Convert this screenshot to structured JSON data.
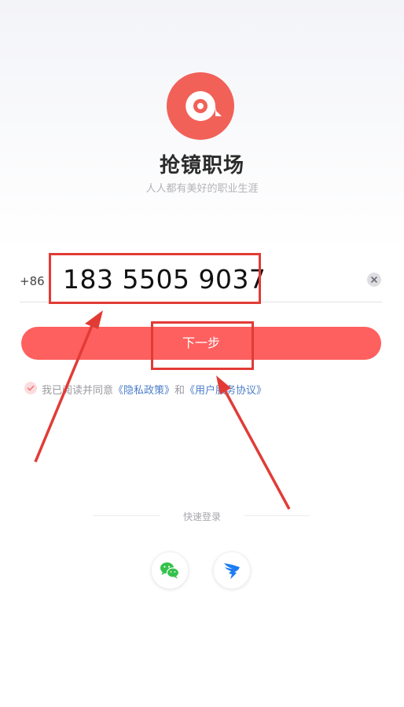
{
  "app": {
    "name": "抢镜职场",
    "slogan": "人人都有美好的职业生涯"
  },
  "login": {
    "country_code": "+86",
    "phone_value": "183 5505 9037",
    "next_label": "下一步"
  },
  "agreement": {
    "prefix": "我已阅读并同意",
    "privacy_link": "《隐私政策》",
    "and_text": "和",
    "service_link": "《用户服务协议》",
    "checked": true
  },
  "quick_login": {
    "label": "快速登录",
    "options": [
      "wechat-icon",
      "dingtalk-icon"
    ]
  },
  "colors": {
    "accent": "#fe605f",
    "logo": "#f16158",
    "link": "#4b7ec9",
    "annotation": "#e23b36",
    "wechat": "#34c24b",
    "dingtalk": "#1e7cf2"
  }
}
